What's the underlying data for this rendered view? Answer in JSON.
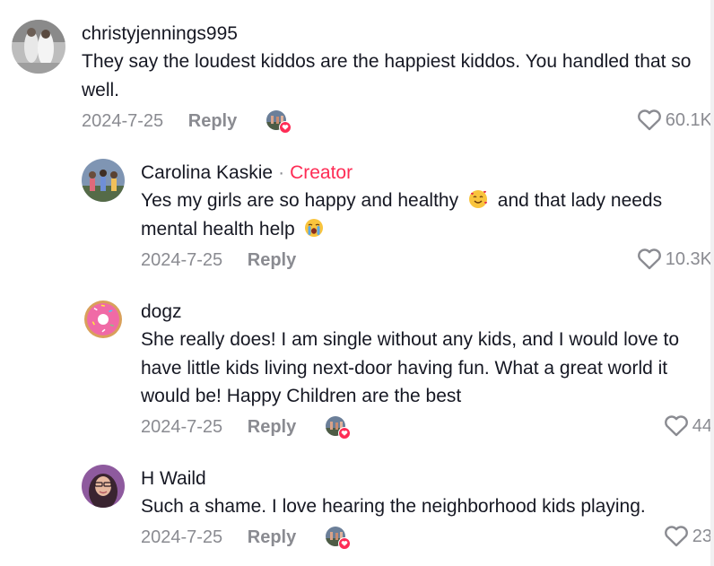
{
  "comments": [
    {
      "username": "christyjennings995",
      "text": "They say the loudest kiddos are the happiest kiddos. You handled that so well.",
      "date": "2024-7-25",
      "reply_label": "Reply",
      "likes": "60.1K",
      "creator_liked": true
    },
    {
      "username": "Carolina Kaskie",
      "separator": "·",
      "creator_label": "Creator",
      "text_part1": "Yes my girls are so happy and healthy",
      "text_part2": "and that lady needs mental health help",
      "emoji1": "smiling-face-with-hearts",
      "emoji2": "loudly-crying-face",
      "date": "2024-7-25",
      "reply_label": "Reply",
      "likes": "10.3K",
      "creator_liked": false
    },
    {
      "username": "dogz",
      "text": "She really does! I am single without any kids, and I would love to have little kids living next-door having fun. What a great world it would be! Happy Children are the best",
      "date": "2024-7-25",
      "reply_label": "Reply",
      "likes": "44",
      "creator_liked": true
    },
    {
      "username": "H Waild",
      "text": "Such a shame. I love hearing the neighborhood kids playing.",
      "date": "2024-7-25",
      "reply_label": "Reply",
      "likes": "23",
      "creator_liked": true
    }
  ],
  "colors": {
    "accent": "#fe2c55",
    "muted": "#8a8b91",
    "text": "#161823"
  },
  "icons": {
    "like": "heart-outline-icon",
    "creator_like_badge": "heart-badge-icon"
  }
}
